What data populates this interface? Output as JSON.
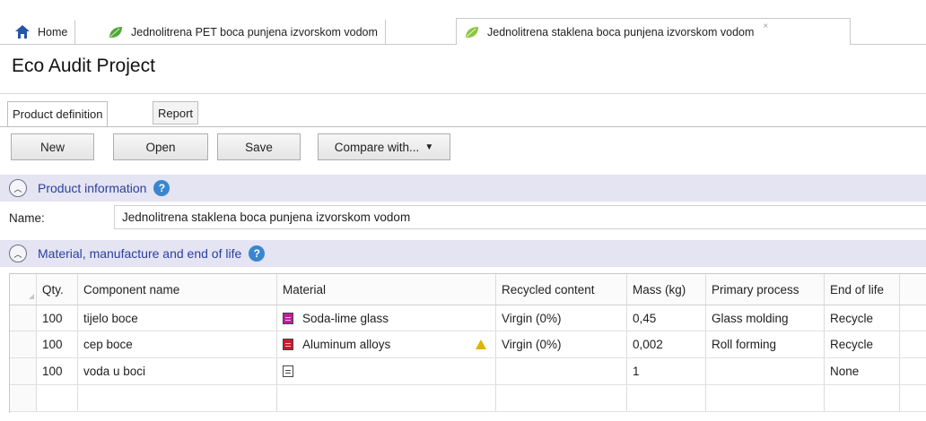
{
  "tabs": [
    {
      "label": "Home",
      "icon": "home-icon"
    },
    {
      "label": "Jednolitrena PET boca punjena izvorskom vodom",
      "icon": "leaf-icon"
    },
    {
      "label": "Jednolitrena staklena boca punjena izvorskom vodom",
      "icon": "leaf-icon",
      "close": "×"
    }
  ],
  "page_title": "Eco Audit Project",
  "subtabs": [
    "Product definition",
    "Report"
  ],
  "toolbar": {
    "new_label": "New",
    "open_label": "Open",
    "save_label": "Save",
    "compare_label": "Compare with..."
  },
  "product_info": {
    "title": "Product information",
    "help": "?",
    "name_label": "Name:",
    "name_value": "Jednolitrena staklena boca punjena izvorskom vodom"
  },
  "materials": {
    "title": "Material, manufacture and end of life",
    "help": "?",
    "columns": [
      "Qty.",
      "Component name",
      "Material",
      "Recycled content",
      "Mass (kg)",
      "Primary process",
      "End of life"
    ],
    "rows": [
      {
        "qty": "100",
        "component": "tijelo boce",
        "material": "Soda-lime glass",
        "swatch": "#c01e9c",
        "recycled": "Virgin (0%)",
        "mass": "0,45",
        "process": "Glass molding",
        "eol": "Recycle",
        "warning": false
      },
      {
        "qty": "100",
        "component": "cep boce",
        "material": "Aluminum alloys",
        "swatch": "#c81d2d",
        "recycled": "Virgin (0%)",
        "mass": "0,002",
        "process": "Roll forming",
        "eol": "Recycle",
        "warning": true
      },
      {
        "qty": "100",
        "component": "voda u boci",
        "material": "",
        "swatch": "#ffffff",
        "recycled": "",
        "mass": "1",
        "process": "",
        "eol": "None",
        "warning": false
      }
    ]
  }
}
